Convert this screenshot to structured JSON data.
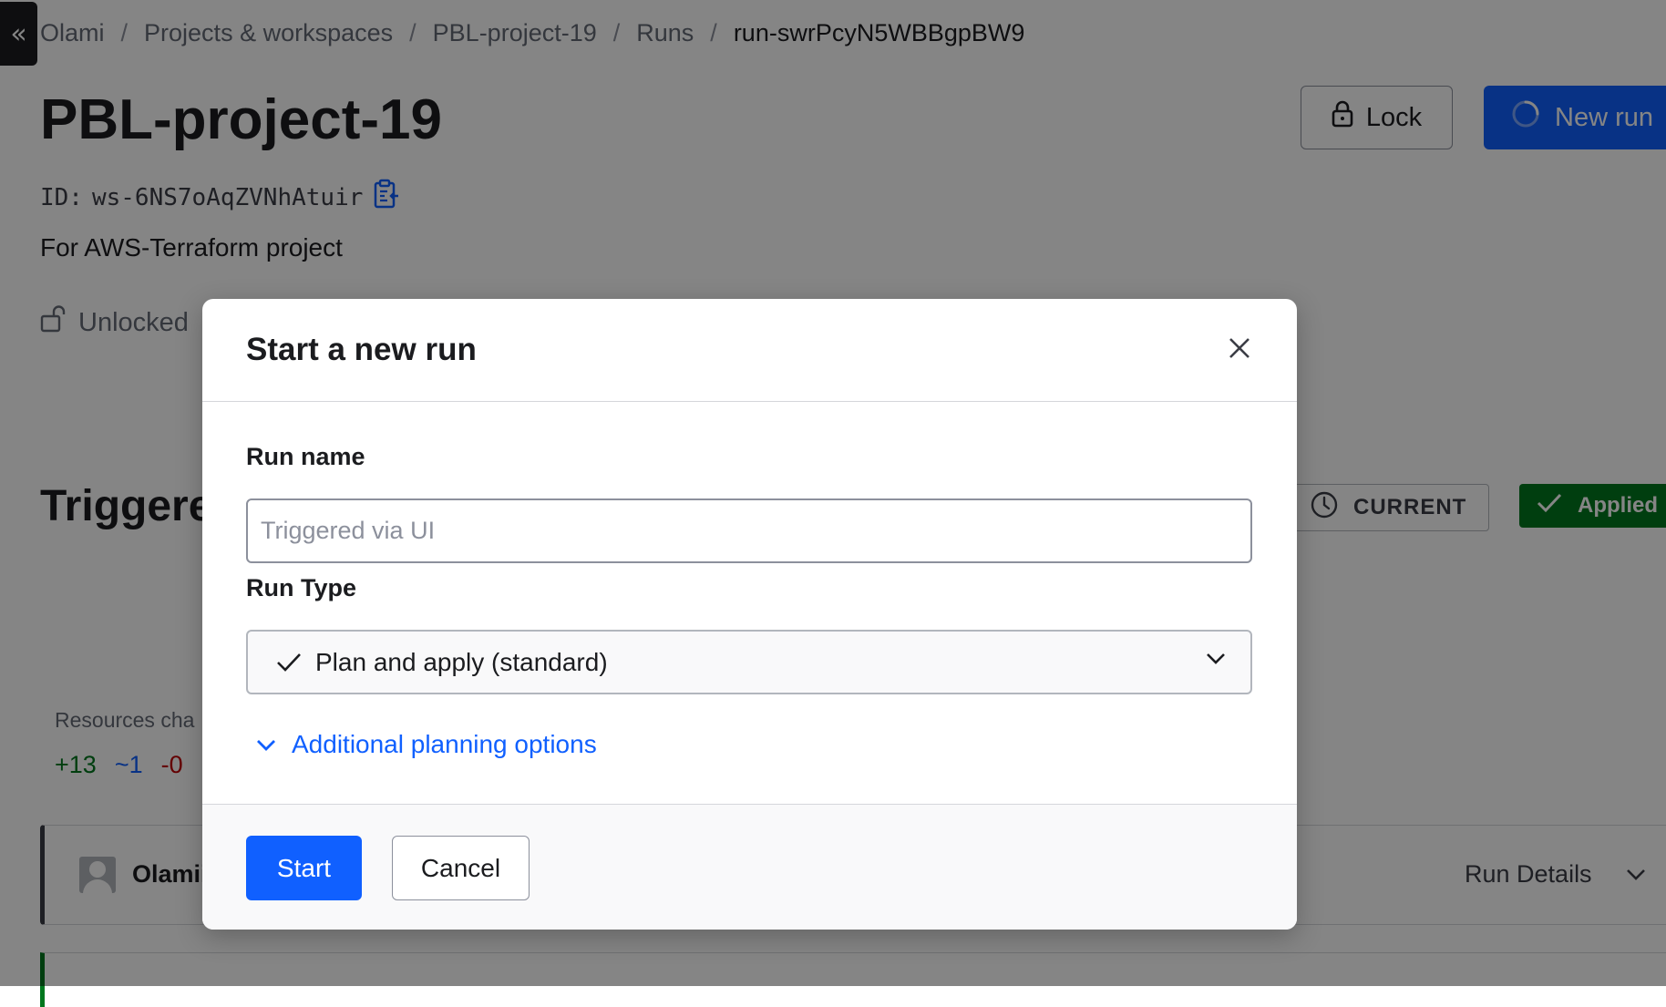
{
  "breadcrumb": {
    "items": [
      "Olami",
      "Projects & workspaces",
      "PBL-project-19",
      "Runs"
    ],
    "current": "run-swrPcyN5WBBgpBW9",
    "separator": "/"
  },
  "workspace": {
    "title": "PBL-project-19",
    "id_label": "ID:",
    "id_value": "ws-6NS7oAqZVNhAtuir",
    "description": "For AWS-Terraform project",
    "lock_status": "Unlocked"
  },
  "header_actions": {
    "lock_label": "Lock",
    "new_run_label": "New run"
  },
  "run": {
    "title": "Triggere",
    "status_current": "CURRENT",
    "status_applied": "Applied",
    "resources_label": "Resources cha",
    "resources_add": "+13",
    "resources_change": "~1",
    "resources_destroy": "-0",
    "user": "Olamii",
    "details_label": "Run Details"
  },
  "modal": {
    "title": "Start a new run",
    "run_name_label": "Run name",
    "run_name_placeholder": "Triggered via UI",
    "run_type_label": "Run Type",
    "run_type_selected": "Plan and apply (standard)",
    "planning_options_label": "Additional planning options",
    "start_label": "Start",
    "cancel_label": "Cancel"
  },
  "icons": {
    "sidebar_collapse": "double-chevron-left-icon",
    "lock": "lock-icon",
    "unlock": "unlock-icon",
    "new_run": "spinner-icon",
    "copy": "clipboard-copy-icon",
    "clock": "clock-icon",
    "check": "check-icon",
    "close": "close-icon",
    "chevron_down": "chevron-down-icon"
  },
  "colors": {
    "primary": "#1060ff",
    "success": "#00781e",
    "danger": "#c00005",
    "overlay": "rgba(0,0,0,0.48)"
  }
}
